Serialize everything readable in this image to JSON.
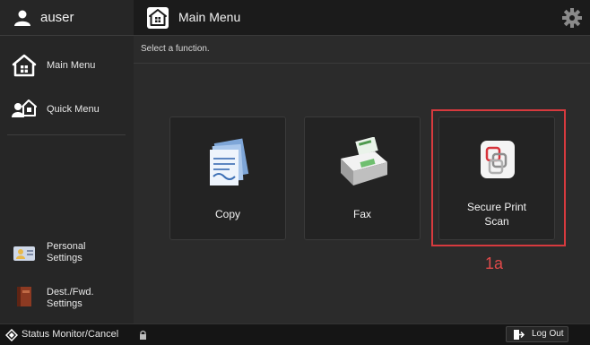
{
  "user": {
    "name": "auser",
    "icon": "user-icon"
  },
  "header": {
    "title": "Main Menu",
    "icon": "home-icon",
    "settings_icon": "gear-icon"
  },
  "sidebar": {
    "items": [
      {
        "label": "Main Menu",
        "icon": "home-icon"
      },
      {
        "label": "Quick Menu",
        "icon": "quick-menu-icon"
      }
    ],
    "personal": {
      "line1": "Personal",
      "line2": "Settings",
      "icon": "personal-settings-icon"
    },
    "dest": {
      "line1": "Dest./Fwd.",
      "line2": "Settings",
      "icon": "address-book-icon"
    }
  },
  "main": {
    "subtitle": "Select a function.",
    "tiles": [
      {
        "label": "Copy",
        "icon": "copy-icon"
      },
      {
        "label": "Fax",
        "icon": "fax-icon"
      },
      {
        "line1": "Secure Print",
        "line2": "Scan",
        "icon": "secure-print-icon"
      }
    ],
    "callout": "1a"
  },
  "statusbar": {
    "status_label": "Status Monitor/Cancel",
    "logout_label": "Log Out"
  },
  "colors": {
    "highlight": "#d73a3e",
    "callout": "#e04a4a"
  }
}
